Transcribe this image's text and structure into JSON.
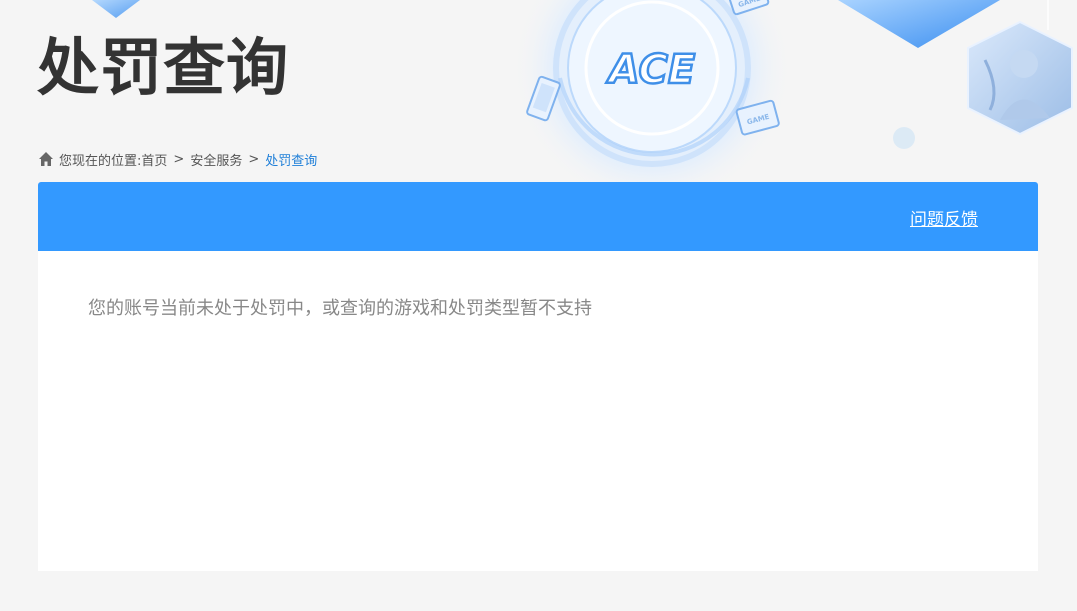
{
  "page": {
    "title": "处罚查询"
  },
  "breadcrumb": {
    "prefix": "您现在的位置:",
    "items": [
      {
        "label": "首页"
      },
      {
        "label": "安全服务"
      },
      {
        "label": "处罚查询"
      }
    ],
    "separator": ">"
  },
  "banner": {
    "logo_text": "ACE",
    "device_label": "GAME"
  },
  "panel": {
    "feedback_label": "问题反馈",
    "message": "您的账号当前未处于处罚中，或查询的游戏和处罚类型暂不支持"
  },
  "colors": {
    "accent": "#3399ff",
    "title": "#333333",
    "breadcrumb_current": "#1f7fd8",
    "message": "#888888",
    "background": "#f5f5f5"
  }
}
